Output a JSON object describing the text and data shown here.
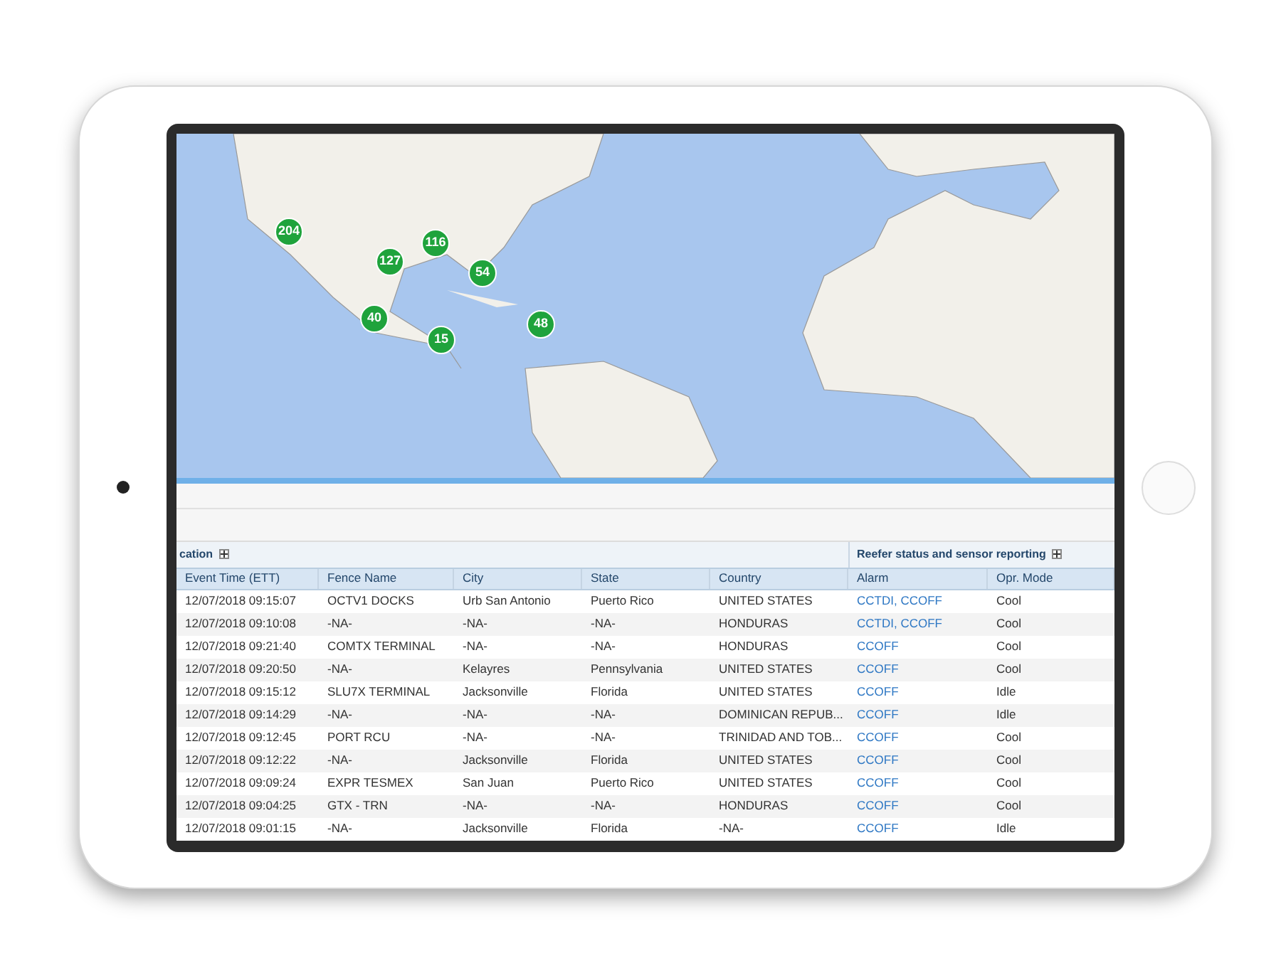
{
  "map": {
    "clusters": [
      {
        "count": "204"
      },
      {
        "count": "127"
      },
      {
        "count": "116"
      },
      {
        "count": "54"
      },
      {
        "count": "40"
      },
      {
        "count": "15"
      },
      {
        "count": "48"
      }
    ]
  },
  "table": {
    "groups": [
      {
        "label": "cation"
      },
      {
        "label": "Reefer status and sensor reporting"
      }
    ],
    "columns": [
      "Event Time (ETT)",
      "Fence Name",
      "City",
      "State",
      "Country",
      "Alarm",
      "Opr. Mode"
    ],
    "rows": [
      [
        "12/07/2018 09:15:07",
        "OCTV1 DOCKS",
        "Urb San Antonio",
        "Puerto Rico",
        "UNITED STATES",
        "CCTDI, CCOFF",
        "Cool"
      ],
      [
        "12/07/2018 09:10:08",
        "-NA-",
        "-NA-",
        "-NA-",
        "HONDURAS",
        "CCTDI, CCOFF",
        "Cool"
      ],
      [
        "12/07/2018 09:21:40",
        "COMTX TERMINAL",
        "-NA-",
        "-NA-",
        "HONDURAS",
        "CCOFF",
        "Cool"
      ],
      [
        "12/07/2018 09:20:50",
        "-NA-",
        "Kelayres",
        "Pennsylvania",
        "UNITED STATES",
        "CCOFF",
        "Cool"
      ],
      [
        "12/07/2018 09:15:12",
        "SLU7X TERMINAL",
        "Jacksonville",
        "Florida",
        "UNITED STATES",
        "CCOFF",
        "Idle"
      ],
      [
        "12/07/2018 09:14:29",
        "-NA-",
        "-NA-",
        "-NA-",
        "DOMINICAN REPUB...",
        "CCOFF",
        "Idle"
      ],
      [
        "12/07/2018 09:12:45",
        "PORT RCU",
        "-NA-",
        "-NA-",
        "TRINIDAD AND TOB...",
        "CCOFF",
        "Cool"
      ],
      [
        "12/07/2018 09:12:22",
        "-NA-",
        "Jacksonville",
        "Florida",
        "UNITED STATES",
        "CCOFF",
        "Cool"
      ],
      [
        "12/07/2018 09:09:24",
        "EXPR TESMEX",
        "San Juan",
        "Puerto Rico",
        "UNITED STATES",
        "CCOFF",
        "Cool"
      ],
      [
        "12/07/2018 09:04:25",
        "GTX - TRN",
        "-NA-",
        "-NA-",
        "HONDURAS",
        "CCOFF",
        "Cool"
      ],
      [
        "12/07/2018 09:01:15",
        "-NA-",
        "Jacksonville",
        "Florida",
        "-NA-",
        "CCOFF",
        "Idle"
      ]
    ]
  }
}
